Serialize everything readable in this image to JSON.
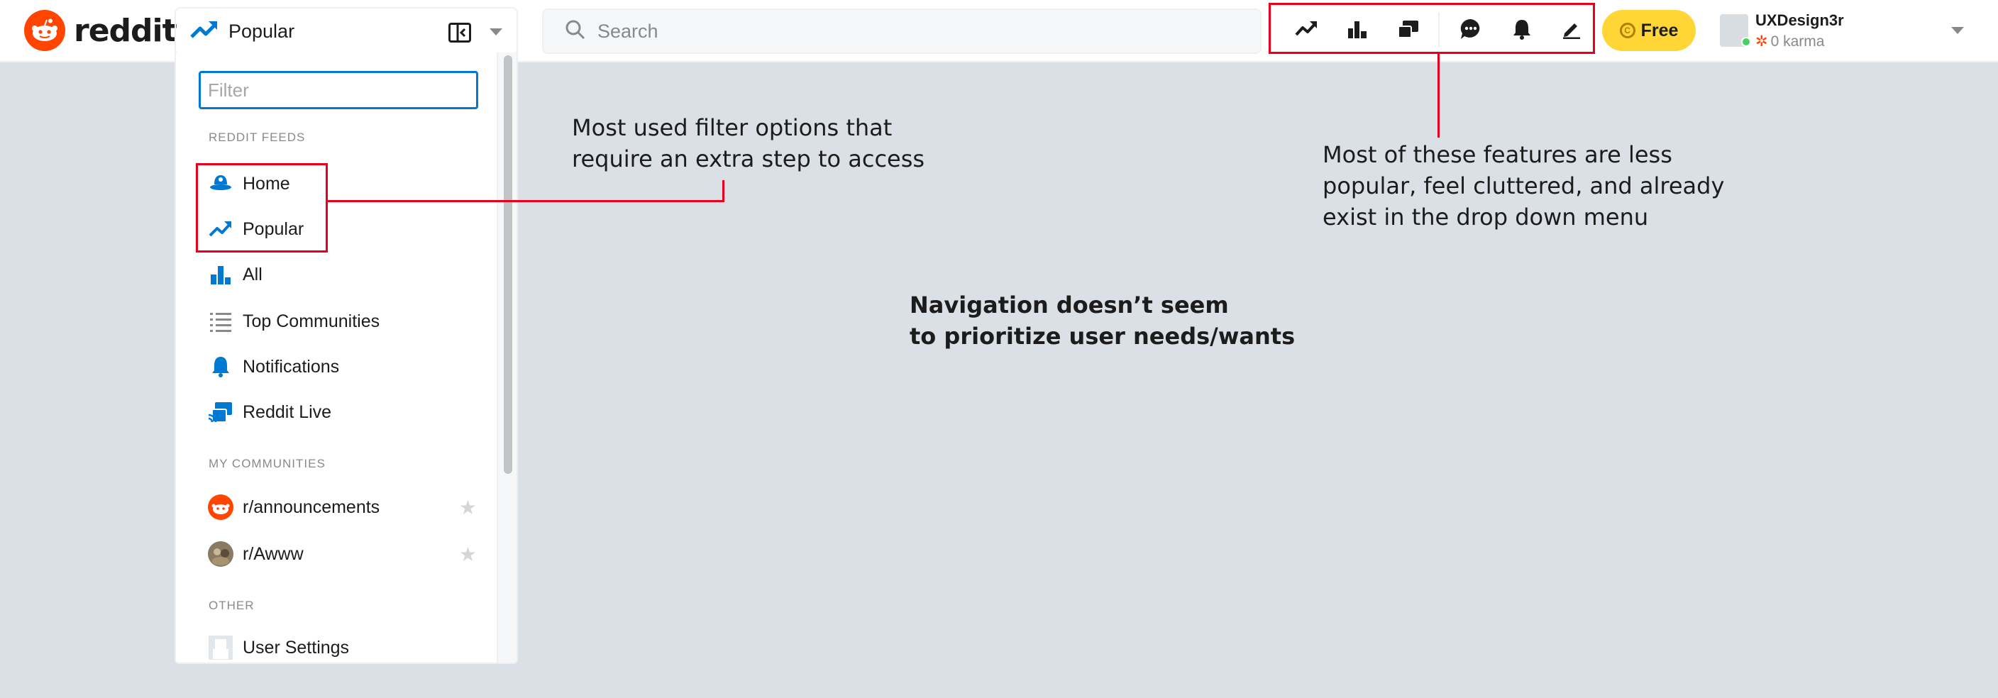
{
  "header": {
    "logo_text": "reddit",
    "feed_select": {
      "label": "Popular",
      "icon": "trending-up-icon"
    },
    "search": {
      "placeholder": "Search",
      "value": ""
    },
    "icons": [
      {
        "name": "popular-icon"
      },
      {
        "name": "all-icon"
      },
      {
        "name": "reddit-live-icon"
      },
      {
        "name": "chat-icon"
      },
      {
        "name": "notifications-icon"
      },
      {
        "name": "create-post-icon"
      }
    ],
    "premium_label": "Free",
    "user": {
      "name": "UXDesign3r",
      "karma": "0 karma"
    }
  },
  "dropdown": {
    "filter_placeholder": "Filter",
    "sections": {
      "feeds": "REDDIT FEEDS",
      "communities": "MY COMMUNITIES",
      "other": "OTHER"
    },
    "feeds": [
      {
        "label": "Home",
        "icon": "home-icon"
      },
      {
        "label": "Popular",
        "icon": "trending-up-icon"
      },
      {
        "label": "All",
        "icon": "bar-chart-icon"
      },
      {
        "label": "Top Communities",
        "icon": "list-icon"
      },
      {
        "label": "Notifications",
        "icon": "bell-icon"
      },
      {
        "label": "Reddit Live",
        "icon": "live-icon"
      }
    ],
    "communities": [
      {
        "label": "r/announcements",
        "icon": "reddit-avatar-icon"
      },
      {
        "label": "r/Awww",
        "icon": "awww-avatar-icon"
      }
    ],
    "other": [
      {
        "label": "User Settings",
        "icon": "user-avatar-icon"
      }
    ]
  },
  "annotations": {
    "filter_note": "Most used filter options that\nrequire an extra step to access",
    "features_note": "Most of these features are less\npopular, feel cluttered, and already\nexist in the drop down menu",
    "navigation_note": "Navigation doesn’t seem\nto prioritize user needs/wants"
  },
  "colors": {
    "brand": "#ff4500",
    "accent_blue": "#0079d3",
    "annotation_red": "#e8001c",
    "page_bg": "#dae0e6",
    "premium_yellow": "#ffd635"
  }
}
